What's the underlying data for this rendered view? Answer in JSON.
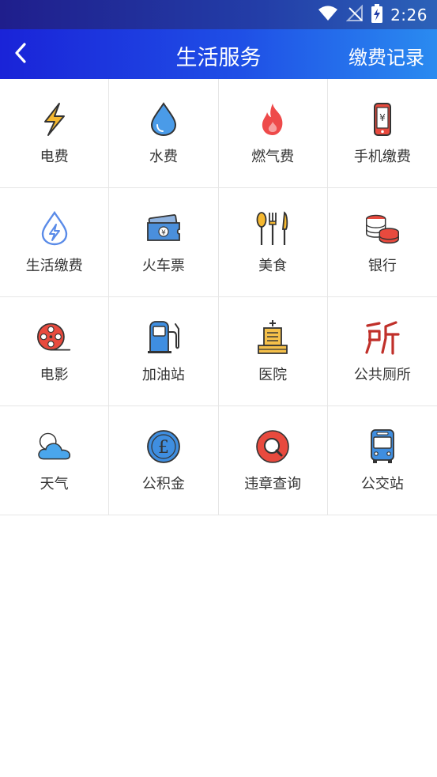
{
  "status_bar": {
    "time": "2:26"
  },
  "navbar": {
    "title": "生活服务",
    "right_label": "缴费记录"
  },
  "services": [
    {
      "label": "电费",
      "icon": "lightning-icon"
    },
    {
      "label": "水费",
      "icon": "water-drop-icon"
    },
    {
      "label": "燃气费",
      "icon": "flame-icon"
    },
    {
      "label": "手机缴费",
      "icon": "phone-yuan-icon"
    },
    {
      "label": "生活缴费",
      "icon": "drop-lightning-icon"
    },
    {
      "label": "火车票",
      "icon": "train-ticket-icon"
    },
    {
      "label": "美食",
      "icon": "cutlery-icon"
    },
    {
      "label": "银行",
      "icon": "coins-icon"
    },
    {
      "label": "电影",
      "icon": "film-reel-icon"
    },
    {
      "label": "加油站",
      "icon": "fuel-pump-icon"
    },
    {
      "label": "医院",
      "icon": "hospital-icon"
    },
    {
      "label": "公共厕所",
      "icon": "toilet-character-icon"
    },
    {
      "label": "天气",
      "icon": "weather-cloud-icon"
    },
    {
      "label": "公积金",
      "icon": "pound-coin-icon"
    },
    {
      "label": "违章查询",
      "icon": "search-violation-icon"
    },
    {
      "label": "公交站",
      "icon": "bus-icon"
    }
  ],
  "colors": {
    "header_start": "#1a23d8",
    "header_end": "#2a8bf0",
    "divider": "#e6e6e6",
    "label_text": "#333333"
  }
}
